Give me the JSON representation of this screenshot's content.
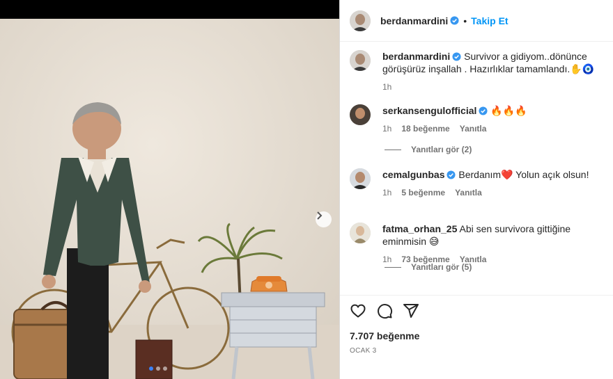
{
  "post": {
    "author": "berdanmardini",
    "separator": "•",
    "follow_label": "Takip Et",
    "caption": "Survivor a gidiyom..dönünce görüşürüz inşallah . Hazırlıklar tamamlandı.✋🧿",
    "caption_time": "1h",
    "likes": "7.707 beğenme",
    "date": "OCAK 3"
  },
  "comments": [
    {
      "user": "serkansengulofficial",
      "verified": true,
      "text": "🔥🔥🔥",
      "time": "1h",
      "likes": "18 beğenme",
      "reply": "Yanıtla",
      "view_replies": "Yanıtları gör (2)"
    },
    {
      "user": "cemalgunbas",
      "verified": true,
      "text": "Berdanım❤️ Yolun açık olsun!",
      "time": "1h",
      "likes": "5 beğenme",
      "reply": "Yanıtla"
    },
    {
      "user": "fatma_orhan_25",
      "verified": false,
      "text": "Abi sen survivora gittiğine eminmisin 😅",
      "time": "1h",
      "likes": "73 beğenme",
      "reply": "Yanıtla",
      "view_replies": "Yanıtları gör (5)"
    }
  ],
  "icons": [
    "heart-icon",
    "comment-icon",
    "share-icon",
    "chevron-right-icon",
    "verified-badge-icon"
  ],
  "colors": {
    "accent": "#0095f6",
    "verified": "#3797f0",
    "text": "#262626",
    "muted": "#737373",
    "backdrop": "#e6ded3"
  }
}
